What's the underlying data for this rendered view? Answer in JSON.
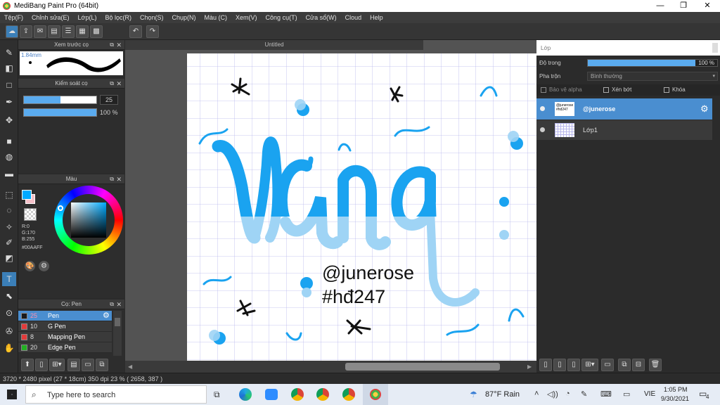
{
  "window": {
    "title": "MediBang Paint Pro (64bit)",
    "min": "—",
    "max": "❐",
    "close": "✕"
  },
  "menu": [
    "Tệp(F)",
    "Chỉnh sửa(E)",
    "Lớp(L)",
    "Bộ lọc(R)",
    "Chọn(S)",
    "Chụp(N)",
    "Màu (C)",
    "Xem(V)",
    "Công cụ(T)",
    "Cửa sổ(W)",
    "Cloud",
    "Help"
  ],
  "preview_panel": {
    "title": "Xem trước cọ",
    "size": "1.84mm"
  },
  "brush_control": {
    "title": "Kiểm soát cọ",
    "size_value": "25",
    "opacity_value": "100 %",
    "size_fraction": 0.25,
    "opacity_fraction": 1.0
  },
  "color_panel": {
    "title": "Màu",
    "r": "R:0",
    "g": "G:170",
    "b": "B:255",
    "hex": "#00AAFF",
    "primary": "#00aaff",
    "secondary": "#f4c0c8"
  },
  "brush_list": {
    "title": "Cọ: Pen",
    "items": [
      {
        "size": "25",
        "name": "Pen",
        "color": "#1a1a1a",
        "selected": true
      },
      {
        "size": "10",
        "name": "G Pen",
        "color": "#e23b3b",
        "selected": false
      },
      {
        "size": "8",
        "name": "Mapping Pen",
        "color": "#e23b3b",
        "selected": false
      },
      {
        "size": "20",
        "name": "Edge Pen",
        "color": "#22b022",
        "selected": false
      }
    ]
  },
  "document": {
    "tab_title": "Untitled"
  },
  "artwork": {
    "word": "Vàng",
    "line1": "@junerose",
    "line2": "#hđ247"
  },
  "layers_panel": {
    "title": "Lớp",
    "opacity_label": "Độ trong",
    "opacity_value": "100 %",
    "blend_label": "Pha trộn",
    "blend_value": "Bình thường",
    "protect_alpha": "Bảo vệ alpha",
    "clipping": "Xén bớt",
    "lock": "Khóa",
    "layers": [
      {
        "name": "@junerose",
        "selected": true
      },
      {
        "name": "Lớp1",
        "selected": false
      }
    ]
  },
  "status": {
    "text": "3720 * 2480 pixel  (27 * 18cm)  350 dpi  23 %  ( 2658, 387 )"
  },
  "taskbar": {
    "search_placeholder": "Type here to search",
    "weather": "87°F  Rain",
    "lang": "VIE",
    "time": "1:05 PM",
    "date": "9/30/2021",
    "notif": "4"
  },
  "colors": {
    "accent": "#3b7fb8",
    "ink_blue": "#1aa3f0",
    "ink_light": "#9fd4f5"
  }
}
